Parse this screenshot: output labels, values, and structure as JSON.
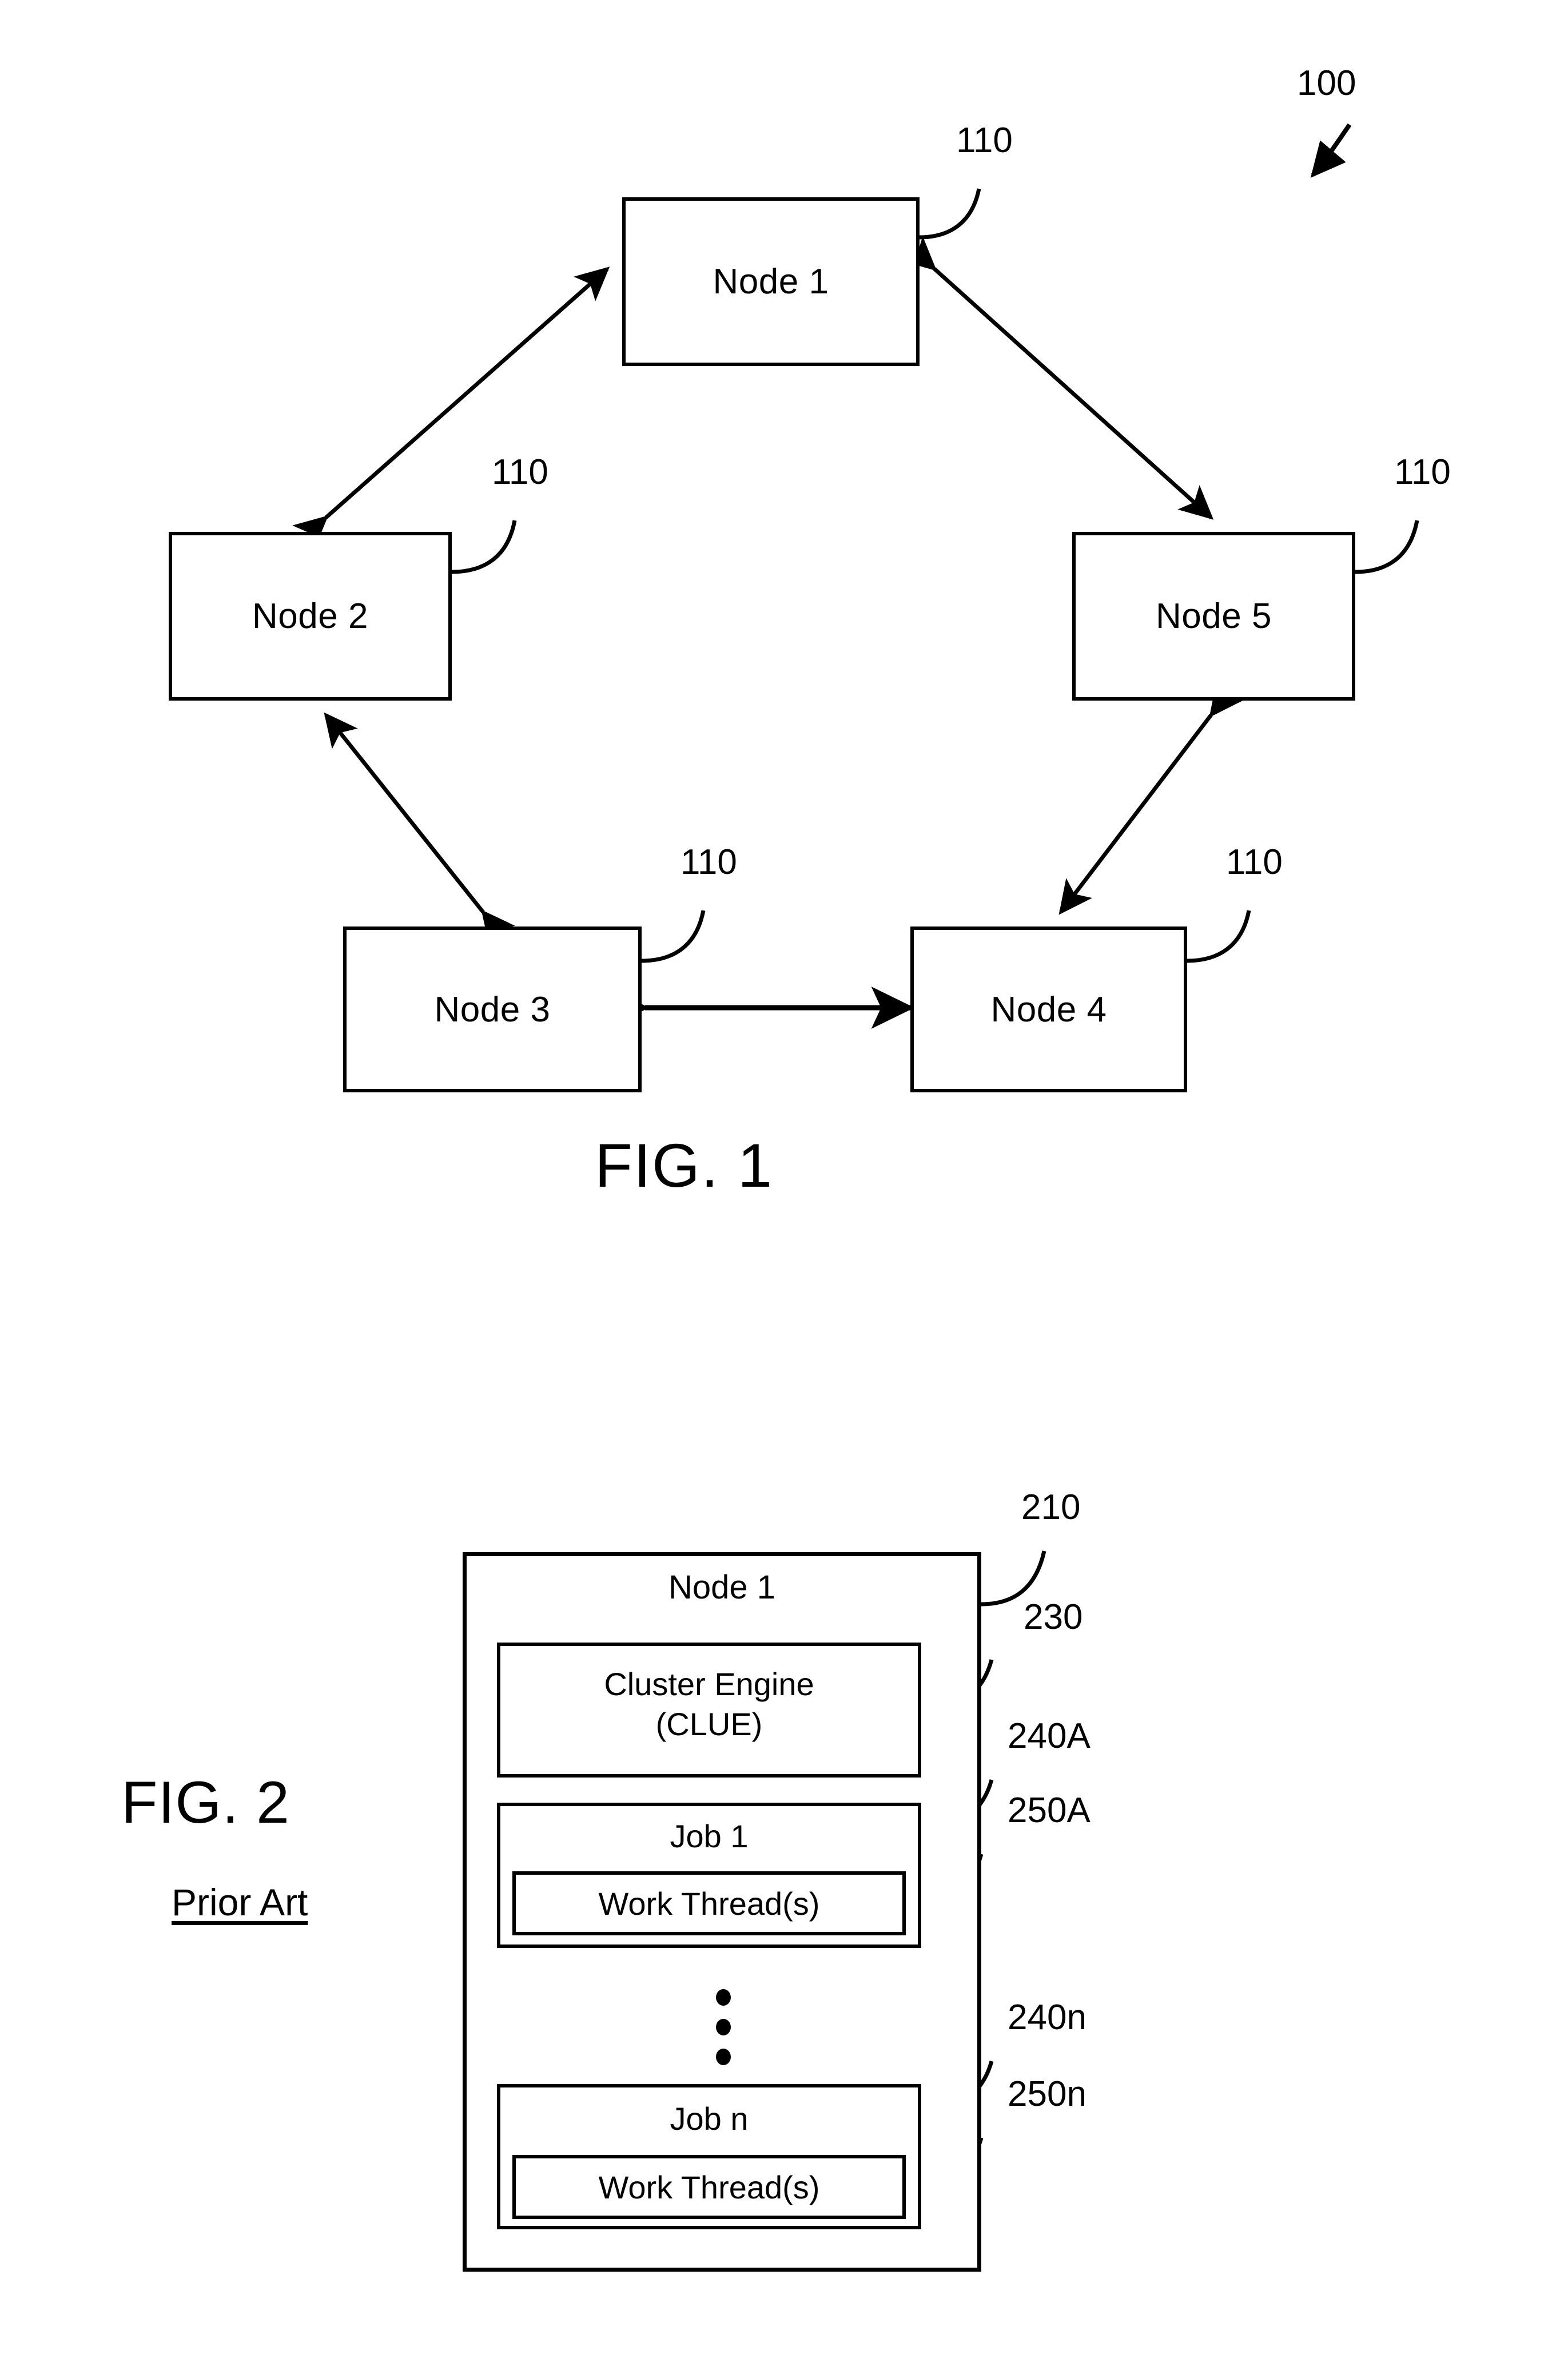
{
  "figure1": {
    "caption": "FIG. 1",
    "system_ref": "100",
    "nodes": [
      {
        "label": "Node 1",
        "ref": "110"
      },
      {
        "label": "Node 2",
        "ref": "110"
      },
      {
        "label": "Node 3",
        "ref": "110"
      },
      {
        "label": "Node 4",
        "ref": "110"
      },
      {
        "label": "Node 5",
        "ref": "110"
      }
    ]
  },
  "figure2": {
    "caption": "FIG. 2",
    "subcaption": "Prior Art",
    "node_title": "Node 1",
    "node_ref": "210",
    "cluster_engine": {
      "line1": "Cluster Engine",
      "line2": "(CLUE)",
      "ref": "230"
    },
    "jobs": [
      {
        "label": "Job 1",
        "ref": "240A",
        "thread_label": "Work Thread(s)",
        "thread_ref": "250A"
      },
      {
        "label": "Job n",
        "ref": "240n",
        "thread_label": "Work Thread(s)",
        "thread_ref": "250n"
      }
    ],
    "ellipsis": "vertical-ellipsis"
  },
  "colors": {
    "ink": "#000000",
    "paper": "#ffffff"
  }
}
